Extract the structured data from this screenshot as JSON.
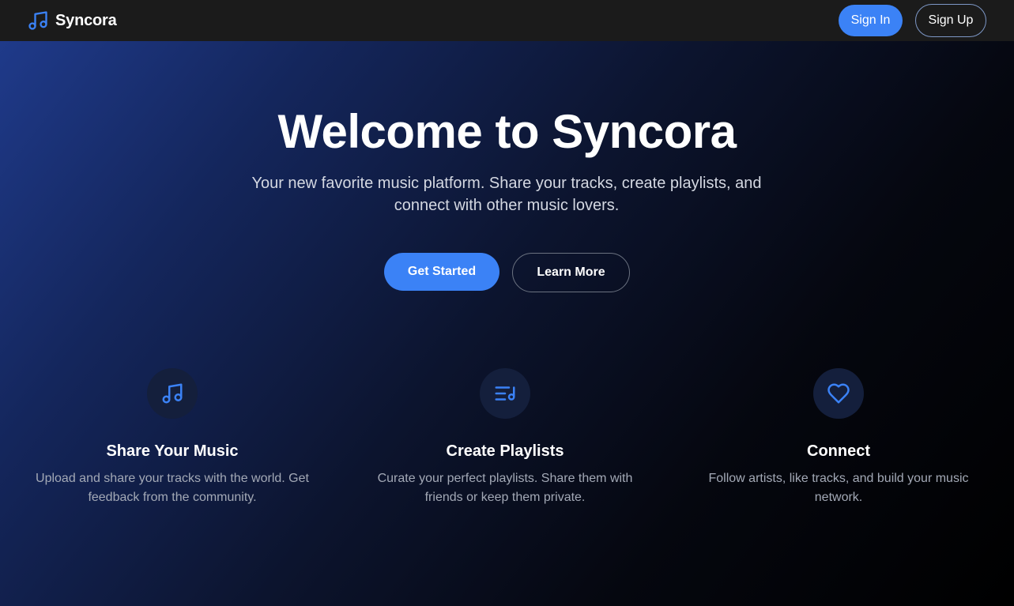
{
  "colors": {
    "accent": "#3b82f6",
    "navbar_bg": "#1b1b1b",
    "icon_circle_bg": "#141f3c",
    "hero_gradient_start": "#1f3a8a",
    "hero_gradient_end": "#000000"
  },
  "navbar": {
    "brand_icon": "music-note-icon",
    "brand_name": "Syncora",
    "sign_in_label": "Sign In",
    "sign_up_label": "Sign Up"
  },
  "hero": {
    "title": "Welcome to Syncora",
    "subtitle": "Your new favorite music platform. Share your tracks, create playlists, and connect with other music lovers.",
    "get_started_label": "Get Started",
    "learn_more_label": "Learn More"
  },
  "features": [
    {
      "icon": "music-note-icon",
      "title": "Share Your Music",
      "description": "Upload and share your tracks with the world. Get feedback from the community."
    },
    {
      "icon": "playlist-icon",
      "title": "Create Playlists",
      "description": "Curate your perfect playlists. Share them with friends or keep them private."
    },
    {
      "icon": "heart-icon",
      "title": "Connect",
      "description": "Follow artists, like tracks, and build your music network."
    }
  ]
}
